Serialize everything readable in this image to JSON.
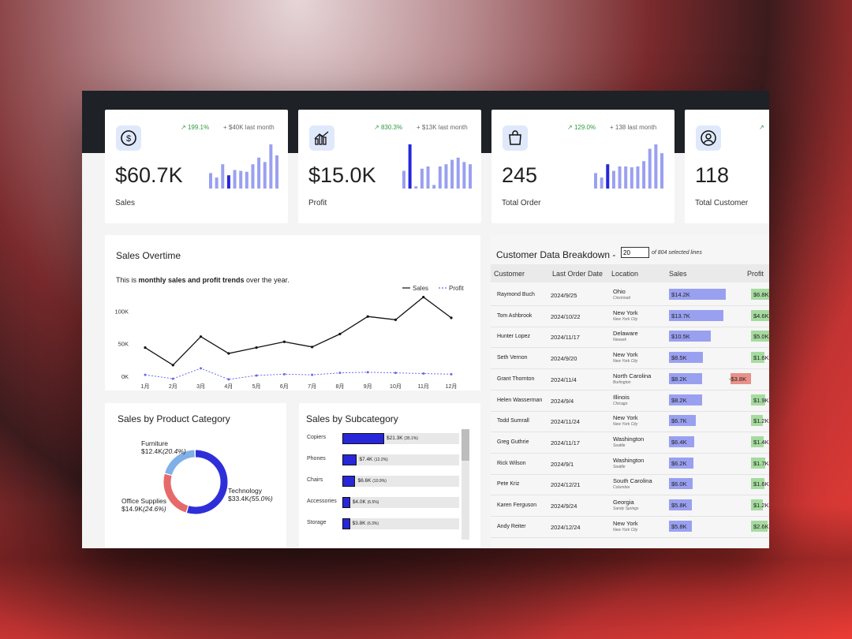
{
  "kpis": [
    {
      "value": "$60.7K",
      "label": "Sales",
      "change": "199.1%",
      "last": "+ $40K last month",
      "icon": "dollar-icon",
      "bars": [
        0.35,
        0.25,
        0.55,
        0.3,
        0.42,
        0.4,
        0.38,
        0.55,
        0.7,
        0.6,
        1.0,
        0.75
      ],
      "highlight": 3
    },
    {
      "value": "$15.0K",
      "label": "Profit",
      "change": "830.3%",
      "last": "+ $13K last month",
      "icon": "chart-icon",
      "bars": [
        0.4,
        1.0,
        0.05,
        0.45,
        0.5,
        0.08,
        0.5,
        0.55,
        0.65,
        0.7,
        0.6,
        0.55
      ],
      "highlight": 1
    },
    {
      "value": "245",
      "label": "Total Order",
      "change": "129.0%",
      "last": "+ 138 last month",
      "icon": "shopping-bag-icon",
      "bars": [
        0.35,
        0.25,
        0.55,
        0.4,
        0.5,
        0.5,
        0.48,
        0.5,
        0.62,
        0.9,
        1.0,
        0.8
      ],
      "highlight": 2
    },
    {
      "value": "118",
      "label": "Total Customer",
      "change": "",
      "last": "",
      "icon": "user-icon",
      "bars": [],
      "highlight": -1
    }
  ],
  "sales_overtime": {
    "title": "Sales Overtime",
    "subtitle_pre": "This is ",
    "subtitle_bold": "monthly sales and profit trends",
    "subtitle_post": " over the year."
  },
  "chart_data": {
    "type": "line",
    "x": [
      "1月",
      "2月",
      "3月",
      "4月",
      "5月",
      "6月",
      "7月",
      "8月",
      "9月",
      "10月",
      "11月",
      "12月"
    ],
    "series": [
      {
        "name": "Sales",
        "values": [
          44000,
          17000,
          61000,
          35000,
          44000,
          53000,
          45000,
          65000,
          92000,
          87000,
          122000,
          90000
        ]
      },
      {
        "name": "Profit",
        "values": [
          2000,
          -4000,
          12000,
          -5000,
          1000,
          3000,
          2000,
          5000,
          6000,
          5000,
          4000,
          3000
        ]
      }
    ],
    "y_ticks": [
      "0K",
      "50K",
      "100K"
    ],
    "ylim": [
      -10000,
      130000
    ],
    "legend": "top-right"
  },
  "category": {
    "title": "Sales by Product Category",
    "slices": [
      {
        "name": "Furniture",
        "amount": "$12.4K",
        "pct": "(20.4%)",
        "share": 20.4,
        "color": "#7fb0e8"
      },
      {
        "name": "Office Supplies",
        "amount": "$14.9K",
        "pct": "(24.6%)",
        "share": 24.6,
        "color": "#e66a6a"
      },
      {
        "name": "Technology",
        "amount": "$33.4K",
        "pct": "(55.0%)",
        "share": 55.0,
        "color": "#2f2fd9"
      }
    ]
  },
  "subcategory": {
    "title": "Sales by Subcategory",
    "items": [
      {
        "name": "Copiers",
        "value": "$21.3K",
        "pct": "(35.1%)",
        "fraction": 0.351
      },
      {
        "name": "Phones",
        "value": "$7.4K",
        "pct": "(12.2%)",
        "fraction": 0.122
      },
      {
        "name": "Chairs",
        "value": "$6.6K",
        "pct": "(10.9%)",
        "fraction": 0.109
      },
      {
        "name": "Accessories",
        "value": "$4.0K",
        "pct": "(6.5%)",
        "fraction": 0.065
      },
      {
        "name": "Storage",
        "value": "$3.8K",
        "pct": "(6.3%)",
        "fraction": 0.063
      }
    ]
  },
  "customers": {
    "title": "Customer Data Breakdown -",
    "lines_input": "20",
    "lines_note": "of 804 selected lines",
    "headers": [
      "Customer",
      "Last Order Date",
      "Location",
      "Sales",
      "Profit"
    ],
    "rows": [
      {
        "name": "Raymond Buch",
        "date": "2024/9/25",
        "state": "Ohio",
        "city": "Cincinnati",
        "sales": "$14.2K",
        "sales_val": 14.2,
        "profit": "$6.8K",
        "profit_val": 6.8
      },
      {
        "name": "Tom Ashbrook",
        "date": "2024/10/22",
        "state": "New York",
        "city": "New York City",
        "sales": "$13.7K",
        "sales_val": 13.7,
        "profit": "$4.6K",
        "profit_val": 4.6
      },
      {
        "name": "Hunter Lopez",
        "date": "2024/11/17",
        "state": "Delaware",
        "city": "Newark",
        "sales": "$10.5K",
        "sales_val": 10.5,
        "profit": "$5.0K",
        "profit_val": 5.0
      },
      {
        "name": "Seth Vernon",
        "date": "2024/9/20",
        "state": "New York",
        "city": "New York City",
        "sales": "$8.5K",
        "sales_val": 8.5,
        "profit": "$1.6K",
        "profit_val": 1.6
      },
      {
        "name": "Grant Thornton",
        "date": "2024/11/4",
        "state": "North Carolina",
        "city": "Burlington",
        "sales": "$8.2K",
        "sales_val": 8.2,
        "profit": "-$3.8K",
        "profit_val": -3.8
      },
      {
        "name": "Helen Wasserman",
        "date": "2024/9/4",
        "state": "Illinois",
        "city": "Chicago",
        "sales": "$8.2K",
        "sales_val": 8.2,
        "profit": "$1.9K",
        "profit_val": 1.9
      },
      {
        "name": "Todd Sumrall",
        "date": "2024/11/24",
        "state": "New York",
        "city": "New York City",
        "sales": "$6.7K",
        "sales_val": 6.7,
        "profit": "$1.2K",
        "profit_val": 1.2
      },
      {
        "name": "Greg Guthrie",
        "date": "2024/11/17",
        "state": "Washington",
        "city": "Seattle",
        "sales": "$6.4K",
        "sales_val": 6.4,
        "profit": "$1.4K",
        "profit_val": 1.4
      },
      {
        "name": "Rick Wilson",
        "date": "2024/9/1",
        "state": "Washington",
        "city": "Seattle",
        "sales": "$6.2K",
        "sales_val": 6.2,
        "profit": "$1.7K",
        "profit_val": 1.7
      },
      {
        "name": "Pete Kriz",
        "date": "2024/12/21",
        "state": "South Carolina",
        "city": "Columbia",
        "sales": "$6.0K",
        "sales_val": 6.0,
        "profit": "$1.6K",
        "profit_val": 1.6
      },
      {
        "name": "Karen Ferguson",
        "date": "2024/9/24",
        "state": "Georgia",
        "city": "Sandy Springs",
        "sales": "$5.8K",
        "sales_val": 5.8,
        "profit": "$1.2K",
        "profit_val": 1.2
      },
      {
        "name": "Andy Reiter",
        "date": "2024/12/24",
        "state": "New York",
        "city": "New York City",
        "sales": "$5.8K",
        "sales_val": 5.8,
        "profit": "$2.6K",
        "profit_val": 2.6
      }
    ]
  },
  "colors": {
    "accent": "#2727d9",
    "bar_light": "#9aa0f0",
    "positive": "#a6dba0",
    "negative": "#e8908a",
    "up": "#2e9a3e"
  }
}
